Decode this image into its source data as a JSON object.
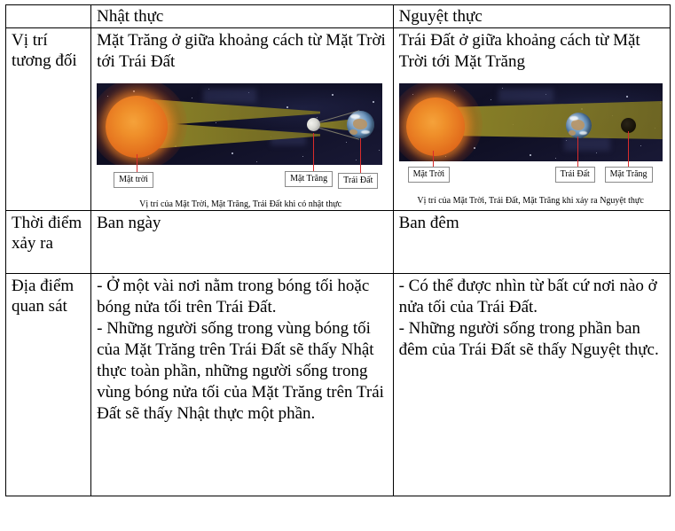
{
  "table": {
    "header": {
      "corner": "",
      "col_solar": "Nhật thực",
      "col_lunar": "Nguyệt thực"
    },
    "rows": [
      {
        "label": "Vị trí tương đối",
        "solar_text": "Mặt Trăng ở giữa khoảng cách từ Mặt Trời tới Trái Đất",
        "lunar_text": "Trái Đất ở giữa khoảng cách từ Mặt Trời tới Mặt Trăng"
      },
      {
        "label": "Thời điểm xảy ra",
        "solar_text": "Ban ngày",
        "lunar_text": "Ban đêm"
      },
      {
        "label": "Địa điểm quan sát",
        "solar_lines": [
          "- Ở một vài nơi nằm trong bóng tối hoặc bóng nửa tối trên Trái Đất.",
          "- Những người sống trong vùng bóng tối của Mặt Trăng trên Trái Đất sẽ thấy Nhật thực toàn phần, những người sống trong vùng bóng nửa tối của Mặt Trăng trên Trái Đất sẽ thấy Nhật thực một phần."
        ],
        "lunar_lines": [
          "- Có thể được nhìn từ bất cứ nơi nào ở nửa tối của Trái Đất.",
          "- Những người sống trong phần ban đêm của Trái Đất sẽ thấy Nguyệt thực."
        ]
      }
    ]
  },
  "figure_solar": {
    "labels": {
      "sun": "Mặt trời",
      "moon": "Mặt Trăng",
      "earth": "Trái Đất"
    },
    "caption": "Vị trí của Mặt Trời, Mặt Trăng, Trái Đất khi có nhật thực",
    "bodies_order": [
      "sun",
      "moon",
      "earth"
    ],
    "colors": {
      "sun": "#ef8f2a",
      "beam": "#968c28",
      "moon": "#d9d9d4",
      "earth": "#5b87b4",
      "space": "#14142c",
      "pointer": "#d92b2b"
    }
  },
  "figure_lunar": {
    "labels": {
      "sun": "Mặt Trời",
      "earth": "Trái Đất",
      "moon": "Mặt Trăng"
    },
    "caption": "Vị trí của Mặt Trời, Trái Đất, Mặt Trăng khi xảy ra Nguyệt thực",
    "bodies_order": [
      "sun",
      "earth",
      "moon"
    ],
    "colors": {
      "sun": "#ef8f2a",
      "beam": "#8a7c24",
      "earth": "#5b87b4",
      "moon_shadowed": "#171208",
      "space": "#14142c",
      "pointer": "#d92b2b"
    }
  }
}
